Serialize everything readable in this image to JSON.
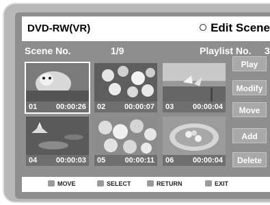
{
  "header": {
    "title": "DVD-RW(VR)",
    "mode": "Edit Scene"
  },
  "subheader": {
    "scene_label": "Scene No.",
    "scene_count": "1/9",
    "playlist_label": "Playlist No.",
    "playlist_number": "3"
  },
  "scenes": [
    {
      "number": "01",
      "time": "00:00:26"
    },
    {
      "number": "02",
      "time": "00:00:07"
    },
    {
      "number": "03",
      "time": "00:00:04"
    },
    {
      "number": "04",
      "time": "00:00:03"
    },
    {
      "number": "05",
      "time": "00:00:11"
    },
    {
      "number": "06",
      "time": "00:00:04"
    }
  ],
  "buttons": {
    "play": "Play",
    "modify": "Modify",
    "move": "Move",
    "add": "Add",
    "delete": "Delete"
  },
  "footer": {
    "move": "MOVE",
    "select": "SELECT",
    "return": "RETURN",
    "exit": "EXIT"
  }
}
